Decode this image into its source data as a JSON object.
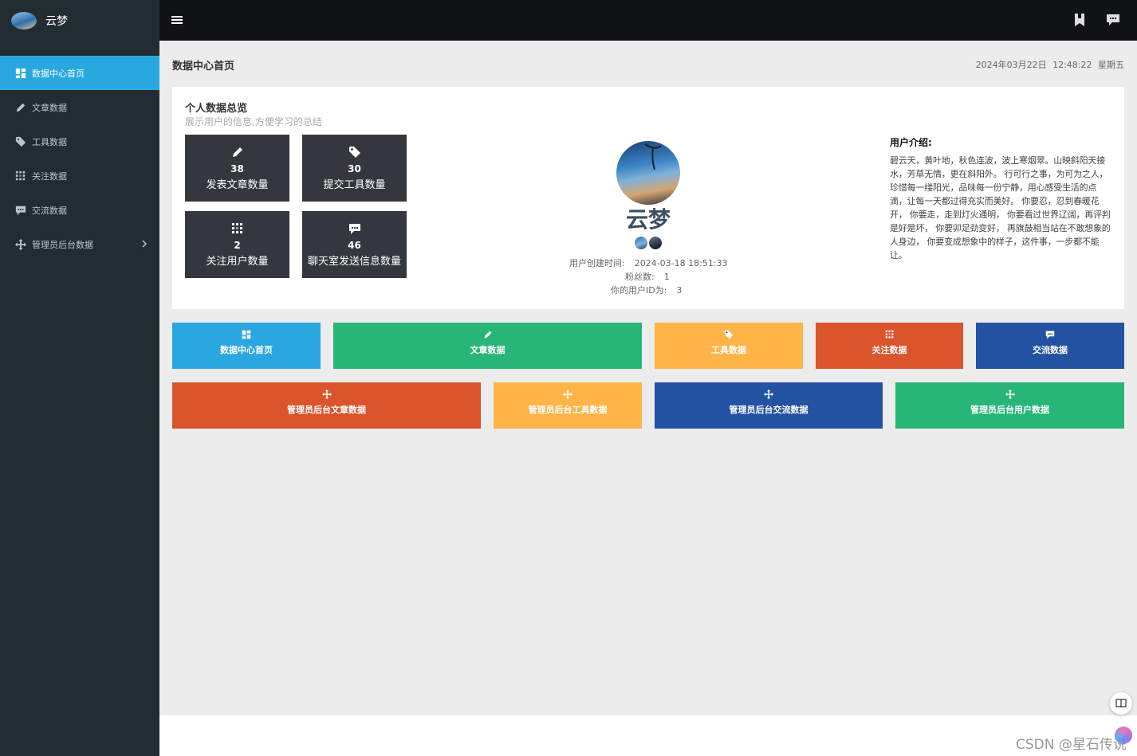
{
  "brand": {
    "name": "云梦",
    "logo_icon": "avatar-logo"
  },
  "sidebar": {
    "items": [
      {
        "label": "数据中心首页",
        "icon": "dashboard-icon",
        "active": true
      },
      {
        "label": "文章数据",
        "icon": "pencil-icon",
        "active": false
      },
      {
        "label": "工具数据",
        "icon": "tag-icon",
        "active": false
      },
      {
        "label": "关注数据",
        "icon": "grid-icon",
        "active": false
      },
      {
        "label": "交流数据",
        "icon": "comment-icon",
        "active": false
      },
      {
        "label": "管理员后台数据",
        "icon": "move-icon",
        "active": false,
        "has_submenu": true
      }
    ]
  },
  "header": {
    "menu_icon": "hamburger-icon",
    "right_icons": [
      "bookmark-icon",
      "comment-icon"
    ]
  },
  "page": {
    "title": "数据中心首页",
    "datetime": "2024年03月22日 12:48:22 星期五"
  },
  "overview": {
    "title": "个人数据总览",
    "subtitle": "展示用户的信息,方便学习的总结",
    "stats": [
      {
        "value": "38",
        "label": "发表文章数量",
        "icon": "pencil-icon"
      },
      {
        "value": "30",
        "label": "提交工具数量",
        "icon": "tag-icon"
      },
      {
        "value": "2",
        "label": "关注用户数量",
        "icon": "grid-icon"
      },
      {
        "value": "46",
        "label": "聊天室发送信息数量",
        "icon": "comment-icon"
      }
    ]
  },
  "profile": {
    "username": "云梦",
    "created_label": "用户创建时间:",
    "created_value": "2024-03-18 18:51:33",
    "fans_label": "粉丝数:",
    "fans_value": "1",
    "uid_label": "你的用户ID为:",
    "uid_value": "3",
    "intro_title": "用户介绍:",
    "intro_text": "碧云天，黄叶地，秋色连波，波上寒烟翠。山映斜阳天接水，芳草无情，更在斜阳外。 行可行之事，为可为之人，珍惜每一缕阳光，品味每一份宁静，用心感受生活的点滴，让每一天都过得充实而美好。 你要忍，忍到春暖花开， 你要走，走到灯火通明， 你要看过世界辽阔，再评判是好是坏， 你要卯足劲变好， 再旗鼓相当站在不敢想象的人身边， 你要变成想象中的样子，这件事，一步都不能让。"
  },
  "tiles_row1": [
    {
      "label": "数据中心首页",
      "icon": "dashboard-icon",
      "color": "#2aa7e1"
    },
    {
      "label": "文章数据",
      "icon": "pencil-icon",
      "color": "#27b677"
    },
    {
      "label": "工具数据",
      "icon": "tag-icon",
      "color": "#ffb447"
    },
    {
      "label": "关注数据",
      "icon": "grid-icon",
      "color": "#da542c"
    },
    {
      "label": "交流数据",
      "icon": "comment-icon",
      "color": "#2352a3"
    }
  ],
  "tiles_row2": [
    {
      "label": "管理员后台文章数据",
      "icon": "move-icon",
      "color": "#da542c"
    },
    {
      "label": "管理员后台工具数据",
      "icon": "move-icon",
      "color": "#ffb447"
    },
    {
      "label": "管理员后台交流数据",
      "icon": "move-icon",
      "color": "#2352a3"
    },
    {
      "label": "管理员后台用户数据",
      "icon": "move-icon",
      "color": "#27b677"
    }
  ],
  "watermark": "CSDN @星石传说"
}
